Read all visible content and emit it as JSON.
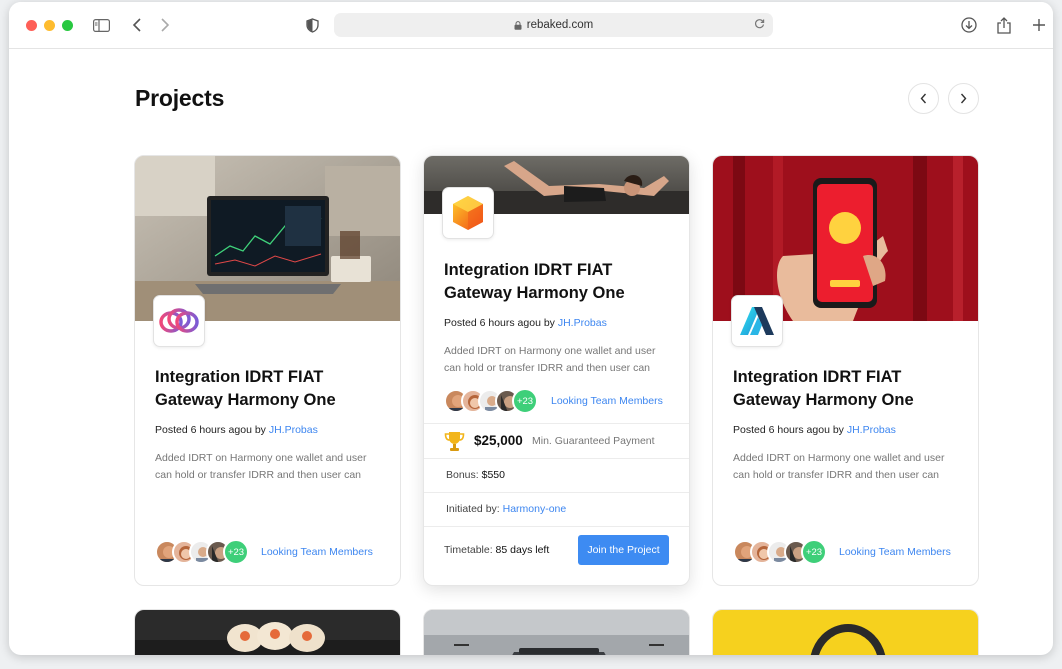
{
  "browser": {
    "url": "rebaked.com",
    "traffic_lights": {
      "close": "#fe5f57",
      "minimize": "#febc2e",
      "zoom": "#28c840"
    },
    "icons": [
      "sidebar-icon",
      "back-icon",
      "forward-icon",
      "shield-icon",
      "lock-icon",
      "reload-icon",
      "download-icon",
      "share-icon",
      "new-tab-icon"
    ]
  },
  "page": {
    "title": "Projects",
    "accent": "#3d86f0",
    "cards": [
      {
        "title": "Integration IDRT FIAT Gateway Harmony One",
        "posted_prefix": "Posted 6 hours agou by ",
        "author": "JH.Probas",
        "description": "Added IDRT on Harmony one wallet and user can hold or transfer IDRR and then user can",
        "avatar_more": "+23",
        "looking": "Looking Team Members",
        "logo": "interlinked-rings-logo"
      },
      {
        "title": "Integration IDRT FIAT Gateway Harmony One",
        "posted_prefix": "Posted 6 hours agou by ",
        "author": "JH.Probas",
        "description": "Added IDRT on Harmony one wallet and user can hold or transfer IDRR and then user can",
        "avatar_more": "+23",
        "looking": "Looking Team Members",
        "logo": "orange-hexagon-logo",
        "amount": "$25,000",
        "amount_label": "Min. Guaranteed Payment",
        "bonus_label": "Bonus: ",
        "bonus_value": "$550",
        "initiated_label": "Initiated by: ",
        "initiated_value": "Harmony-one",
        "timetable_label": "Timetable: ",
        "timetable_value": "85 days left",
        "join_label": "Join the Project"
      },
      {
        "title": "Integration IDRT FIAT Gateway Harmony One",
        "posted_prefix": "Posted 6 hours agou by ",
        "author": "JH.Probas",
        "description": "Added IDRT on Harmony one wallet and user can hold or transfer IDRR and then user can",
        "avatar_more": "+23",
        "looking": "Looking Team Members",
        "logo": "blue-angular-logo"
      }
    ]
  }
}
